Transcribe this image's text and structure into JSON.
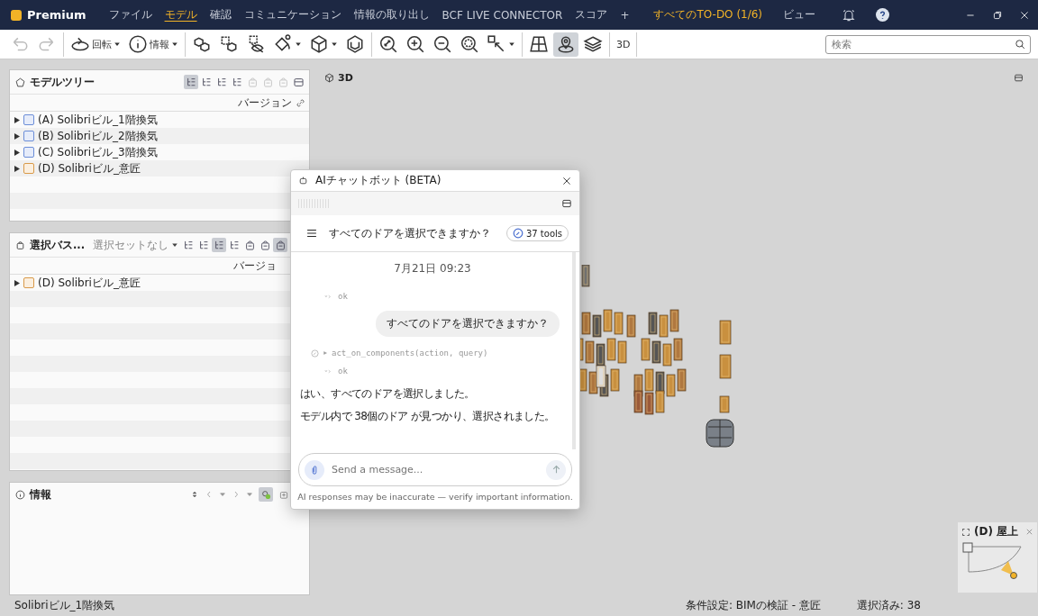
{
  "app": {
    "name": "Premium"
  },
  "menu": [
    {
      "label": "ファイル",
      "selected": false
    },
    {
      "label": "モデル",
      "selected": true
    },
    {
      "label": "確認",
      "selected": false
    },
    {
      "label": "コミュニケーション",
      "selected": false
    },
    {
      "label": "情報の取り出し",
      "selected": false
    },
    {
      "label": "BCF LIVE CONNECTOR",
      "selected": false
    },
    {
      "label": "スコア",
      "selected": false
    },
    {
      "label": "+",
      "selected": false
    }
  ],
  "todo": "すべてのTO-DO (1/6)",
  "view_menu": "ビュー",
  "toolbar": {
    "groups": [
      {
        "tools": [
          {
            "disabled": true,
            "selected": false,
            "dropdown": false
          },
          {
            "disabled": true,
            "selected": false,
            "dropdown": false
          }
        ]
      },
      {
        "tools": [
          {
            "label": "回転",
            "disabled": false,
            "selected": false,
            "dropdown": true
          },
          {
            "label": "情報",
            "disabled": false,
            "selected": false,
            "dropdown": true
          }
        ]
      },
      {
        "tools": [
          {
            "disabled": false,
            "selected": false,
            "dropdown": false
          },
          {
            "disabled": false,
            "selected": false,
            "dropdown": false
          },
          {
            "disabled": false,
            "selected": false,
            "dropdown": false
          },
          {
            "disabled": false,
            "selected": false,
            "dropdown": true
          },
          {
            "disabled": false,
            "selected": false,
            "dropdown": true
          },
          {
            "disabled": false,
            "selected": false,
            "dropdown": false
          }
        ]
      },
      {
        "tools": [
          {
            "disabled": false,
            "selected": false,
            "dropdown": false
          },
          {
            "disabled": false,
            "selected": false,
            "dropdown": false
          },
          {
            "disabled": false,
            "selected": false,
            "dropdown": false
          },
          {
            "disabled": false,
            "selected": false,
            "dropdown": false
          },
          {
            "disabled": false,
            "selected": false,
            "dropdown": true
          }
        ]
      },
      {
        "tools": [
          {
            "disabled": false,
            "selected": false,
            "dropdown": false
          },
          {
            "disabled": false,
            "selected": true,
            "dropdown": false
          },
          {
            "disabled": false,
            "selected": false,
            "dropdown": false
          }
        ]
      },
      {
        "tools": [
          {
            "label": "3D",
            "disabled": false,
            "selected": false,
            "dropdown": false
          }
        ]
      }
    ],
    "search": {
      "placeholder": "検索"
    }
  },
  "model_tree": {
    "title": "モデルツリー",
    "tools": [
      {
        "selected": true,
        "disabled": false
      },
      {
        "selected": false,
        "disabled": false
      },
      {
        "selected": false,
        "disabled": false
      },
      {
        "selected": false,
        "disabled": false
      },
      {
        "selected": false,
        "disabled": true
      },
      {
        "selected": false,
        "disabled": true
      },
      {
        "selected": false,
        "disabled": true
      },
      {
        "selected": false,
        "disabled": false
      }
    ],
    "column": "バージョン",
    "rows": [
      {
        "label": "(A) Solibriビル_1階換気",
        "kind": "ventilation"
      },
      {
        "label": "(B) Solibriビル_2階換気",
        "kind": "ventilation"
      },
      {
        "label": "(C) Solibriビル_3階換気",
        "kind": "ventilation"
      },
      {
        "label": "(D) Solibriビル_意匠",
        "kind": "architecture"
      }
    ]
  },
  "selection_basket": {
    "title": "選択バス...",
    "set_dropdown": "選択セットなし",
    "tools": [
      {
        "selected": false,
        "disabled": false
      },
      {
        "selected": false,
        "disabled": false
      },
      {
        "selected": true,
        "disabled": false
      },
      {
        "selected": false,
        "disabled": false
      },
      {
        "selected": false,
        "disabled": false
      },
      {
        "selected": false,
        "disabled": false
      },
      {
        "selected": true,
        "disabled": false
      }
    ],
    "column": "バージョ",
    "rows": [
      {
        "label": "(D) Solibriビル_意匠",
        "kind": "architecture"
      }
    ]
  },
  "info_panel": {
    "title": "情報"
  },
  "viewport": {
    "label": "3D"
  },
  "chatbot": {
    "title": "AIチャットボット (BETA)",
    "conversation": "すべてのドアを選択できますか？",
    "tools_badge": "37 tools",
    "date": "7月21日 09:23",
    "messages": [
      {
        "kind": "result",
        "text": "ok"
      },
      {
        "kind": "user",
        "text": "すべてのドアを選択できますか？"
      },
      {
        "kind": "tool_call",
        "text": "act_on_components(action, query)"
      },
      {
        "kind": "result",
        "text": "ok"
      },
      {
        "kind": "assistant",
        "text": "はい、すべてのドアを選択しました。"
      },
      {
        "kind": "assistant",
        "text": "モデル内で 38個のドア が見つかり、選択されました。"
      }
    ],
    "input": {
      "placeholder": "Send a message..."
    },
    "disclaimer": "AI responses may be inaccurate — verify important information."
  },
  "minimap": {
    "title": "(D) 屋上"
  },
  "status_bar": {
    "model": "Solibriビル_1階換気",
    "rule": "条件設定: BIMの検証 - 意匠",
    "selected": "選択済み: 38"
  }
}
